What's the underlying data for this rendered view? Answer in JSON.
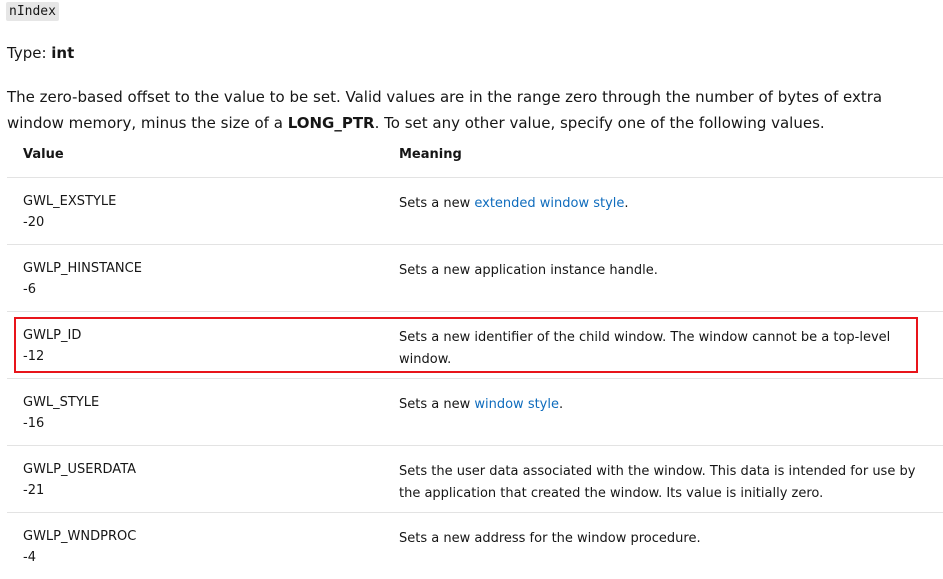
{
  "param": {
    "name": "nIndex",
    "type_label": "Type: ",
    "type_value": "int"
  },
  "description": {
    "part1": "The zero-based offset to the value to be set. Valid values are in the range zero through the number of bytes of extra window memory, minus the size of a ",
    "bold": "LONG_PTR",
    "part2": ". To set any other value, specify one of the following values."
  },
  "table": {
    "headers": {
      "value": "Value",
      "meaning": "Meaning"
    },
    "rows": [
      {
        "name": "GWL_EXSTYLE",
        "num": "-20",
        "meaning_pre": "Sets a new ",
        "meaning_link": "extended window style",
        "meaning_post": "."
      },
      {
        "name": "GWLP_HINSTANCE",
        "num": "-6",
        "meaning_pre": "Sets a new application instance handle.",
        "meaning_link": "",
        "meaning_post": ""
      },
      {
        "name": "GWLP_ID",
        "num": "-12",
        "meaning_pre": "Sets a new identifier of the child window. The window cannot be a top-level window.",
        "meaning_link": "",
        "meaning_post": ""
      },
      {
        "name": "GWL_STYLE",
        "num": "-16",
        "meaning_pre": "Sets a new ",
        "meaning_link": "window style",
        "meaning_post": "."
      },
      {
        "name": "GWLP_USERDATA",
        "num": "-21",
        "meaning_pre": "Sets the user data associated with the window. This data is intended for use by the application that created the window. Its value is initially zero.",
        "meaning_link": "",
        "meaning_post": ""
      },
      {
        "name": "GWLP_WNDPROC",
        "num": "-4",
        "meaning_pre": "Sets a new address for the window procedure.",
        "meaning_link": "",
        "meaning_post": ""
      }
    ]
  },
  "colors": {
    "link": "#0f6cbd",
    "highlight": "#e8141a",
    "divider": "#e3e3e3"
  }
}
